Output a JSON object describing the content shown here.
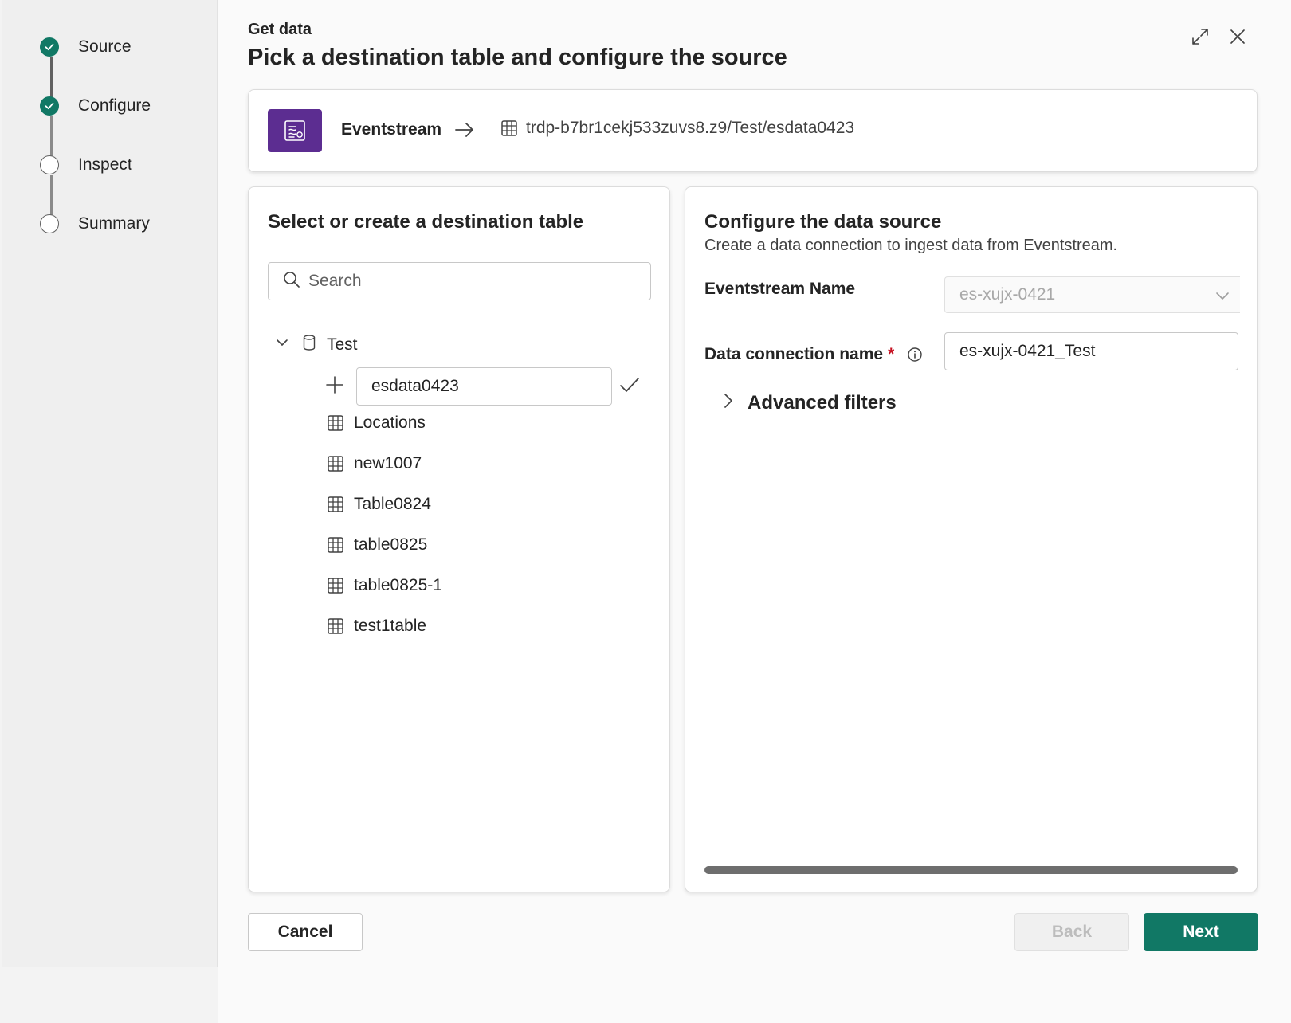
{
  "wizard": {
    "steps": [
      {
        "label": "Source",
        "status": "completed"
      },
      {
        "label": "Configure",
        "status": "completed"
      },
      {
        "label": "Inspect",
        "status": "pending"
      },
      {
        "label": "Summary",
        "status": "pending"
      }
    ]
  },
  "header": {
    "eyebrow": "Get data",
    "title": "Pick a destination table and configure the source"
  },
  "source_bar": {
    "source_name": "Eventstream",
    "destination_path": "trdp-b7br1cekj533zuvs8.z9/Test/esdata0423"
  },
  "left_panel": {
    "title": "Select or create a destination table",
    "search_placeholder": "Search",
    "database": "Test",
    "new_table_value": "esdata0423",
    "tables": [
      "Locations",
      "new1007",
      "Table0824",
      "table0825",
      "table0825-1",
      "test1table"
    ]
  },
  "right_panel": {
    "title": "Configure the data source",
    "subtitle": "Create a data connection to ingest data from Eventstream.",
    "eventstream_name_label": "Eventstream Name",
    "eventstream_name_value": "es-xujx-0421",
    "connection_name_label": "Data connection name",
    "required_marker": "*",
    "connection_name_value": "es-xujx-0421_Test",
    "advanced_filters_label": "Advanced filters"
  },
  "footer": {
    "cancel_label": "Cancel",
    "back_label": "Back",
    "next_label": "Next"
  },
  "colors": {
    "accent": "#117865",
    "eventstream_brand": "#5c2d91",
    "required": "#c50f1f"
  },
  "icons": [
    "check-icon",
    "expand-icon",
    "close-icon",
    "eventstream-icon",
    "arrow-right-icon",
    "table-icon",
    "search-icon",
    "chevron-down-icon",
    "database-icon",
    "plus-icon",
    "checkmark-icon",
    "info-icon",
    "chevron-right-icon"
  ]
}
